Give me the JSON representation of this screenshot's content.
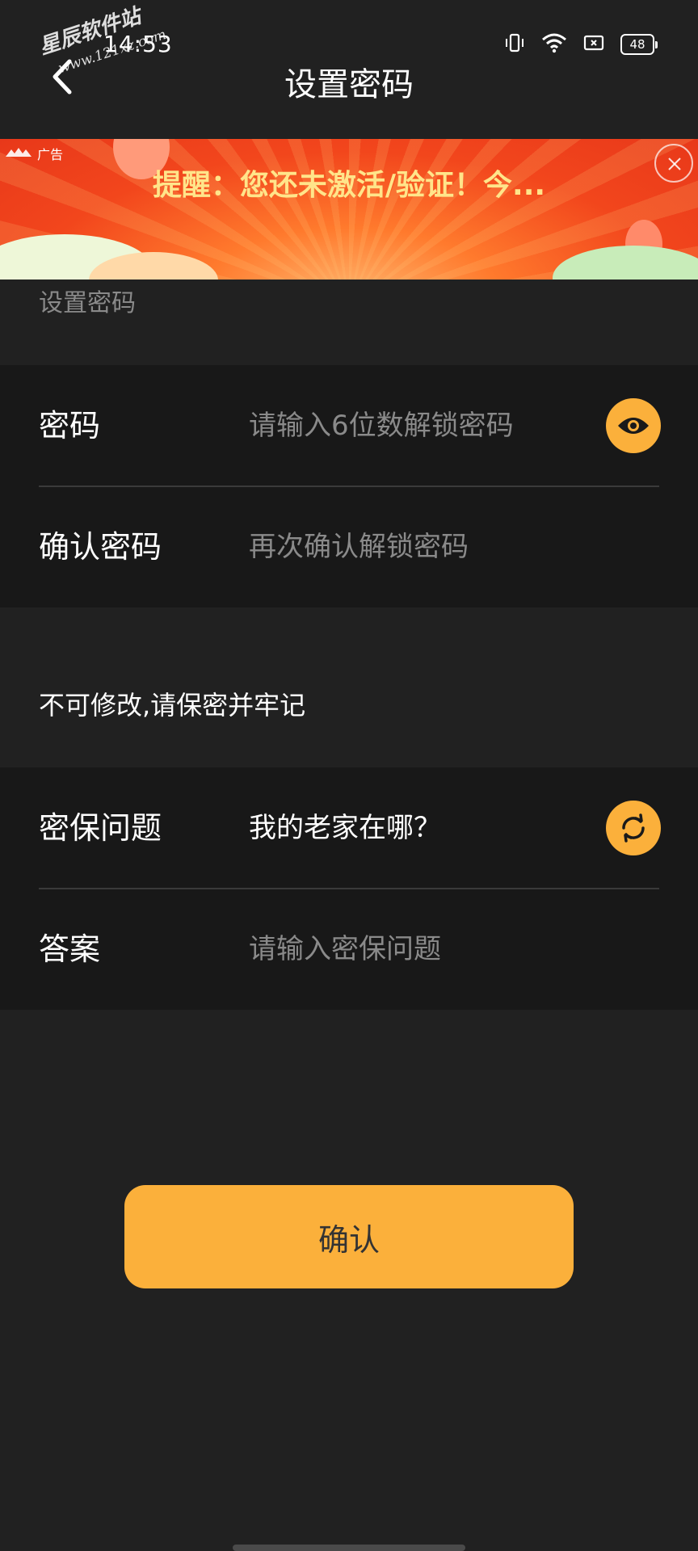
{
  "status_bar": {
    "time": "14:53",
    "battery_level": "48",
    "icons": [
      "vibrate-icon",
      "wifi-icon",
      "sim-icon",
      "battery-icon"
    ]
  },
  "watermark": {
    "title": "星辰软件站",
    "url": "www.121xz.com"
  },
  "header": {
    "title": "设置密码",
    "back_icon": "chevron-left-icon"
  },
  "ad": {
    "label": "广告",
    "text": "提醒：您还未激活/验证！今...",
    "close_icon": "close-icon"
  },
  "section_caption": "设置密码",
  "password_form": {
    "password_label": "密码",
    "password_placeholder": "请输入6位数解锁密码",
    "toggle_visibility_icon": "eye-icon",
    "confirm_label": "确认密码",
    "confirm_placeholder": "再次确认解锁密码"
  },
  "note": "不可修改,请保密并牢记",
  "security_form": {
    "question_label": "密保问题",
    "question_value": "我的老家在哪？",
    "refresh_icon": "refresh-icon",
    "answer_label": "答案",
    "answer_placeholder": "请输入密保问题"
  },
  "confirm_button": "确认",
  "colors": {
    "background": "#212121",
    "card": "#181818",
    "accent": "#fbb03b",
    "placeholder": "#8a8a8a",
    "ad_text": "#ffe58a"
  }
}
